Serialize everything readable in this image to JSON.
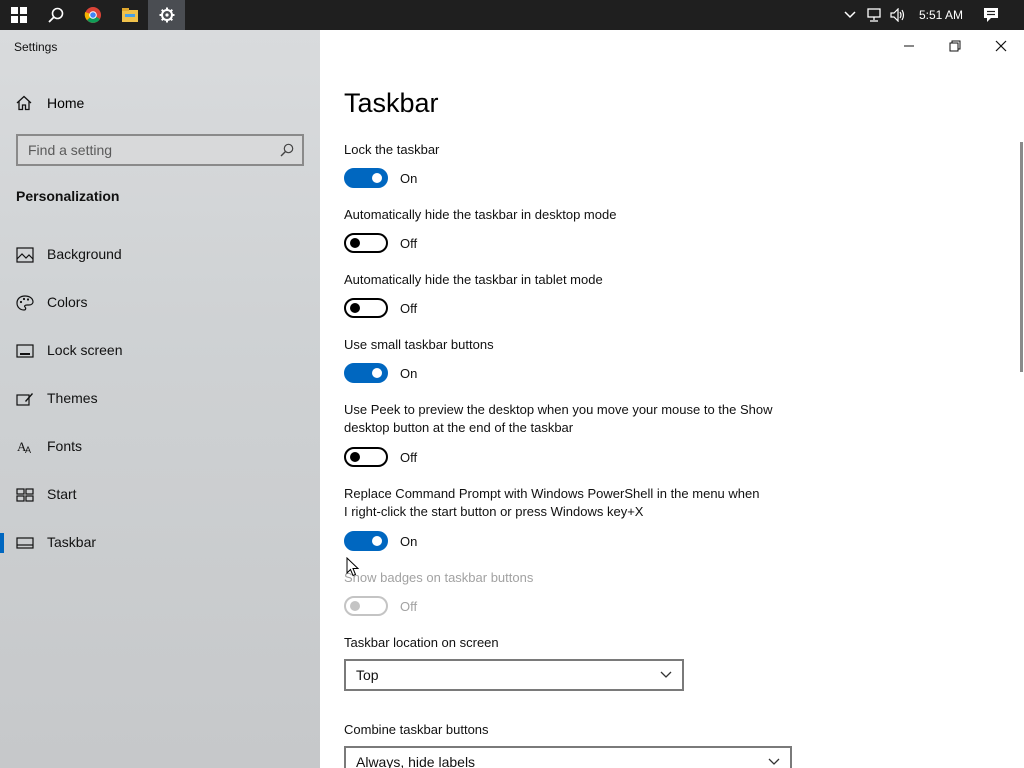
{
  "taskbar": {
    "time": "5:51 AM",
    "icons": [
      "windows-start-icon",
      "search-icon",
      "chrome-icon",
      "file-explorer-icon",
      "settings-icon"
    ],
    "tray_icons": [
      "chevron-up-icon",
      "network-icon",
      "volume-icon",
      "action-center-icon"
    ]
  },
  "sidebar": {
    "app_title": "Settings",
    "home_label": "Home",
    "search_placeholder": "Find a setting",
    "section_heading": "Personalization",
    "items": [
      {
        "label": "Background",
        "icon": "background-icon"
      },
      {
        "label": "Colors",
        "icon": "palette-icon"
      },
      {
        "label": "Lock screen",
        "icon": "lock-screen-icon"
      },
      {
        "label": "Themes",
        "icon": "themes-icon"
      },
      {
        "label": "Fonts",
        "icon": "fonts-icon"
      },
      {
        "label": "Start",
        "icon": "start-icon"
      },
      {
        "label": "Taskbar",
        "icon": "taskbar-icon",
        "selected": true
      }
    ]
  },
  "main": {
    "title": "Taskbar",
    "settings": [
      {
        "label": "Lock the taskbar",
        "state": "On"
      },
      {
        "label": "Automatically hide the taskbar in desktop mode",
        "state": "Off"
      },
      {
        "label": "Automatically hide the taskbar in tablet mode",
        "state": "Off"
      },
      {
        "label": "Use small taskbar buttons",
        "state": "On"
      },
      {
        "label": "Use Peek to preview the desktop when you move your mouse to the Show desktop button at the end of the taskbar",
        "state": "Off"
      },
      {
        "label": "Replace Command Prompt with Windows PowerShell in the menu when I right-click the start button or press Windows key+X",
        "state": "On"
      },
      {
        "label": "Show badges on taskbar buttons",
        "state": "Off",
        "disabled": true
      }
    ],
    "location": {
      "label": "Taskbar location on screen",
      "value": "Top"
    },
    "combine": {
      "label": "Combine taskbar buttons",
      "value": "Always, hide labels"
    }
  },
  "colors": {
    "accent": "#0067c0",
    "taskbar_bg": "#1f1f1f",
    "sidebar_bg": "#cfd2d4"
  }
}
